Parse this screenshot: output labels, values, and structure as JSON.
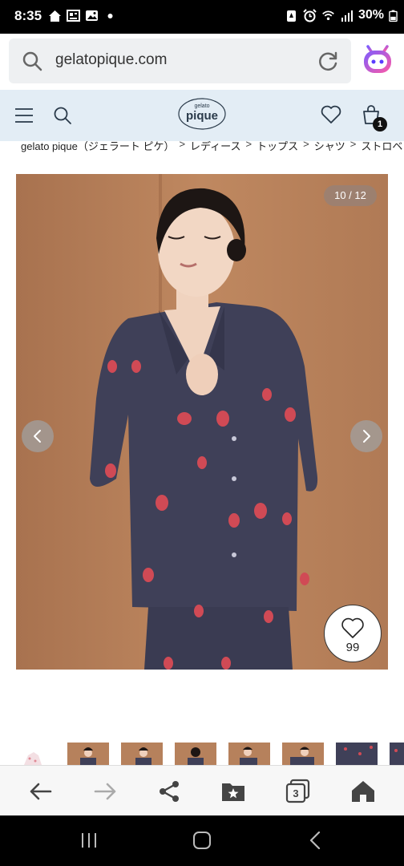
{
  "status_bar": {
    "time": "8:35",
    "battery": "30%",
    "icons": [
      "home-icon",
      "news-icon",
      "gallery-icon",
      "dot-icon",
      "notification-icon",
      "alarm-icon",
      "wifi-icon",
      "signal-icon",
      "battery-icon"
    ]
  },
  "browser": {
    "url": "gelatopique.com",
    "tab_count": "3"
  },
  "site_header": {
    "logo_small": "gelato",
    "logo_main": "pique",
    "cart_count": "1"
  },
  "breadcrumb": {
    "items": [
      "gelato pique（ジェラート ピケ）",
      "レディース",
      "トップス",
      "シャツ",
      "ストロベ"
    ],
    "separator": ">"
  },
  "product": {
    "image_counter": "10 / 12",
    "favorite_count": "99"
  },
  "colors": {
    "header_bg": "#e3edf5",
    "url_bar_bg": "#eef0f2",
    "image_bg": "#b37a55",
    "pajama": "#3f4058",
    "strawberry": "#d04a55"
  }
}
